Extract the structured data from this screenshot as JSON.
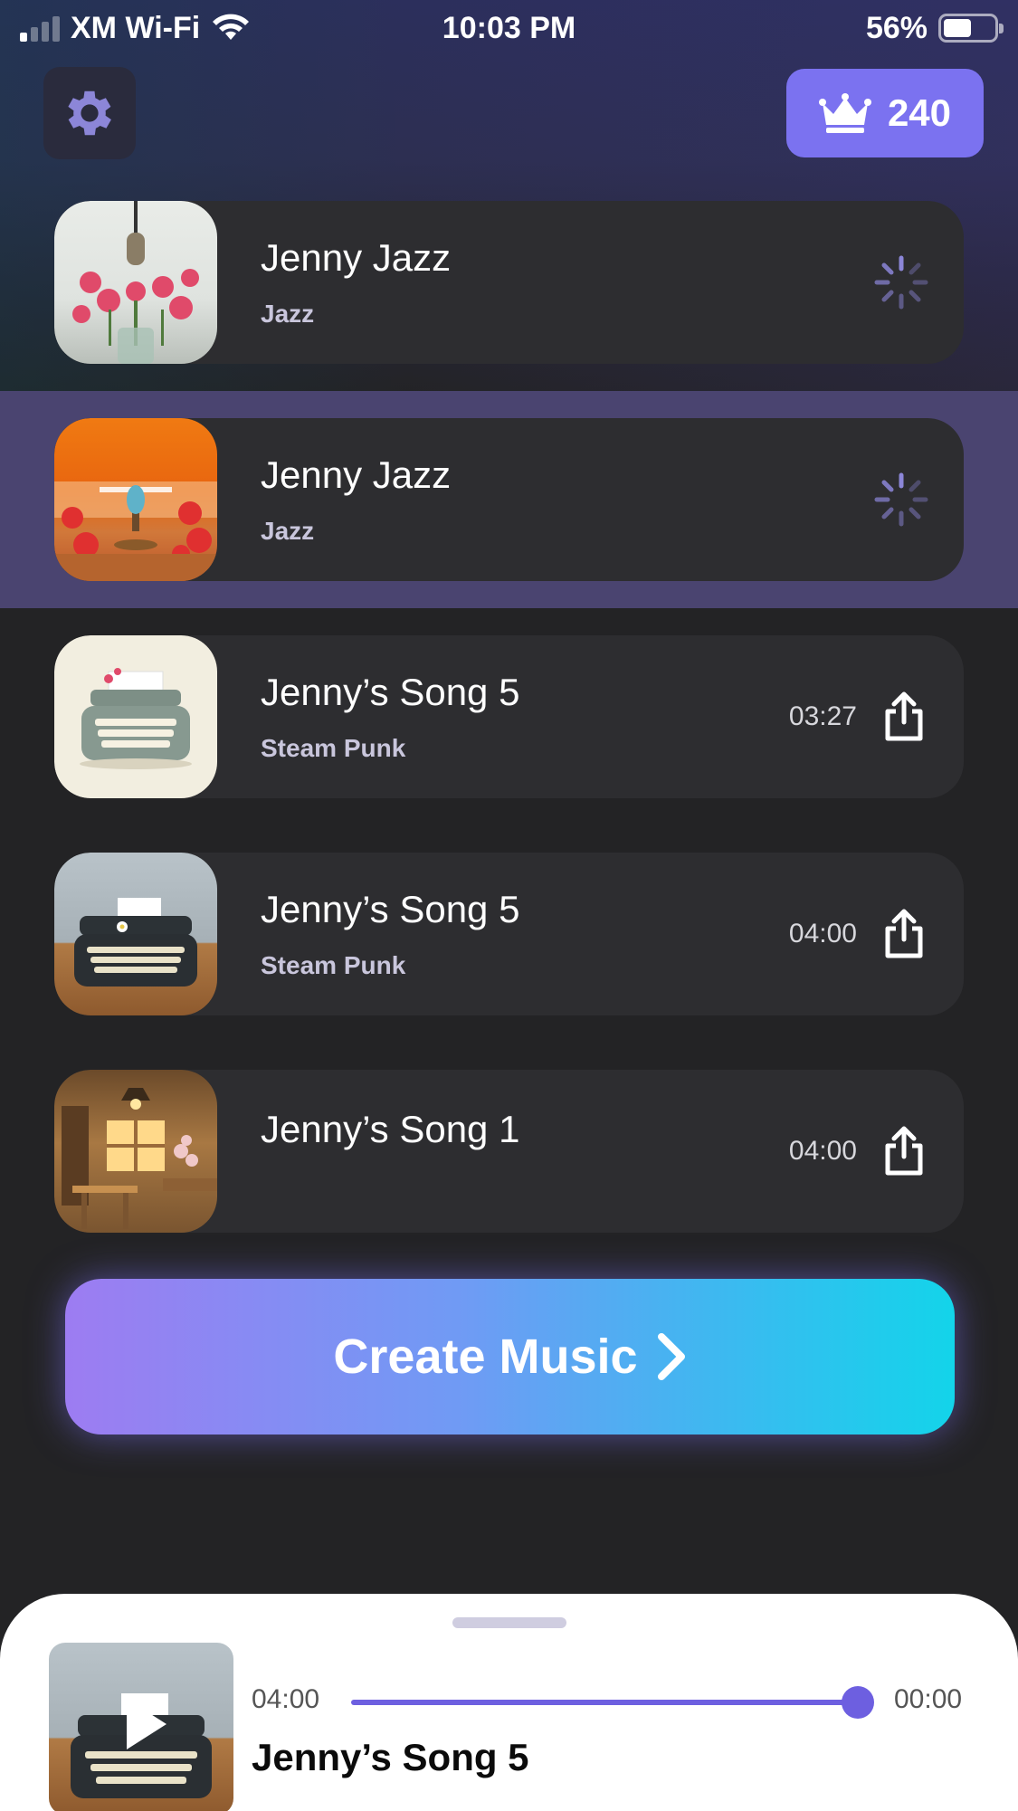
{
  "status_bar": {
    "carrier": "XM Wi-Fi",
    "time": "10:03 PM",
    "battery": "56%"
  },
  "header": {
    "credits": "240"
  },
  "songs": [
    {
      "title": "Jenny Jazz",
      "genre": "Jazz",
      "duration": "",
      "state": "generating"
    },
    {
      "title": "Jenny Jazz",
      "genre": "Jazz",
      "duration": "",
      "state": "generating"
    },
    {
      "title": "Jenny’s Song 5",
      "genre": "Steam Punk",
      "duration": "03:27",
      "state": "ready"
    },
    {
      "title": "Jenny’s Song 5",
      "genre": "Steam Punk",
      "duration": "04:00",
      "state": "ready"
    },
    {
      "title": "Jenny’s Song 1",
      "genre": "",
      "duration": "04:00",
      "state": "ready"
    }
  ],
  "create_button": {
    "label": "Create Music"
  },
  "player": {
    "time_left": "04:00",
    "time_right": "00:00",
    "progress": 1.0,
    "title": "Jenny’s Song 5"
  },
  "colors": {
    "accent": "#7b72f0",
    "progress": "#6d5fe0",
    "selected_row": "#4a4470"
  }
}
